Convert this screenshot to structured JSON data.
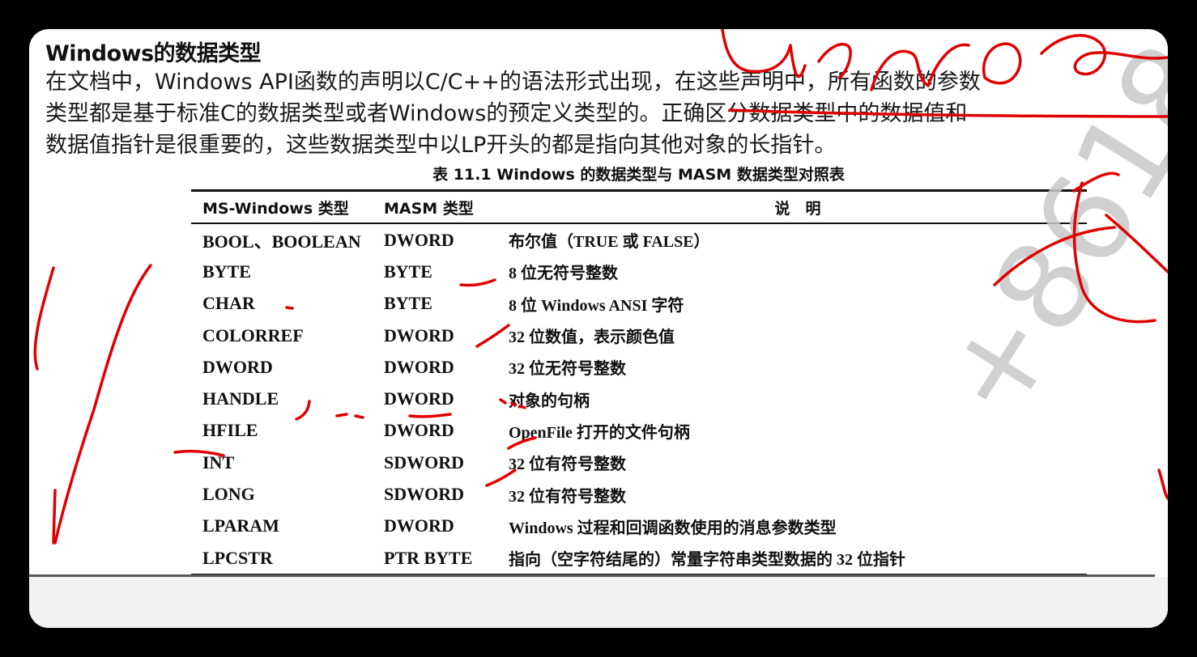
{
  "slide": {
    "title": "Windows的数据类型",
    "intro_lines": [
      "在文档中，Windows API函数的声明以C/C++的语法形式出现，在这些声明中，所有函数的参数",
      "类型都是基于标准C的数据类型或者Windows的预定义类型的。正确区分数据类型中的数据值和",
      "数据值指针是很重要的，这些数据类型中以LP开头的都是指向其他对象的长指针。"
    ]
  },
  "table": {
    "caption": "表 11.1   Windows 的数据类型与 MASM 数据类型对照表",
    "headers": [
      "MS-Windows 类型",
      "MASM 类型",
      "说　明"
    ],
    "rows": [
      {
        "win": "BOOL、BOOLEAN",
        "masm": "DWORD",
        "desc": "布尔值（TRUE 或 FALSE）"
      },
      {
        "win": "BYTE",
        "masm": "BYTE",
        "desc": "8 位无符号整数"
      },
      {
        "win": "CHAR",
        "masm": "BYTE",
        "desc": "8 位 Windows ANSI 字符"
      },
      {
        "win": "COLORREF",
        "masm": "DWORD",
        "desc": "32 位数值，表示颜色值"
      },
      {
        "win": "DWORD",
        "masm": "DWORD",
        "desc": "32 位无符号整数"
      },
      {
        "win": "HANDLE",
        "masm": "DWORD",
        "desc": "对象的句柄"
      },
      {
        "win": "HFILE",
        "masm": "DWORD",
        "desc": "OpenFile 打开的文件句柄"
      },
      {
        "win": "INT",
        "masm": "SDWORD",
        "desc": "32 位有符号整数"
      },
      {
        "win": "LONG",
        "masm": "SDWORD",
        "desc": "32 位有符号整数"
      },
      {
        "win": "LPARAM",
        "masm": "DWORD",
        "desc": "Windows 过程和回调函数使用的消息参数类型"
      },
      {
        "win": "LPCSTR",
        "masm": "PTR BYTE",
        "desc": "指向（空字符结尾的）常量字符串类型数据的 32 位指针"
      }
    ]
  },
  "watermark": {
    "text": "+8618"
  },
  "colors": {
    "annotation": "#e00000",
    "background": "#000000",
    "page": "#ffffff"
  }
}
